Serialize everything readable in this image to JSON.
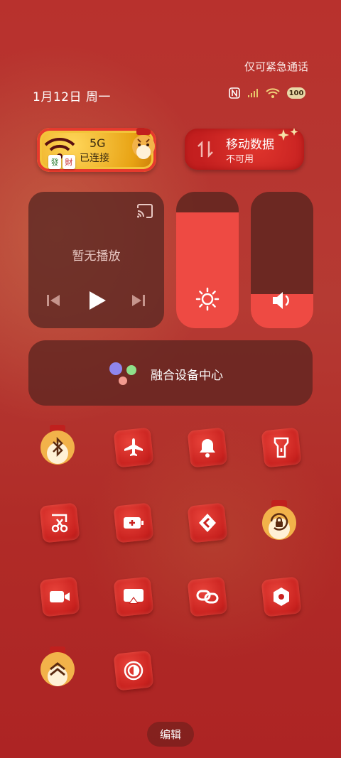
{
  "status_bar": {
    "emergency_text": "仅可紧急通话",
    "date": "1月12日 周一",
    "battery": "100",
    "icons": [
      "nfc-icon",
      "signal-icon",
      "wifi-icon",
      "battery-icon"
    ]
  },
  "wifi_tile": {
    "name": "5G",
    "sub": "已连接",
    "mahjong": [
      "發",
      "財"
    ]
  },
  "data_tile": {
    "title": "移动数据",
    "subtitle": "不可用"
  },
  "media": {
    "status": "暂无播放"
  },
  "sliders": {
    "brightness_level": 0.85,
    "volume_level": 0.25
  },
  "device_center": {
    "label": "融合设备中心"
  },
  "toggles": [
    {
      "name": "bluetooth",
      "icon": "bluetooth-icon"
    },
    {
      "name": "airplane-mode",
      "icon": "airplane-icon"
    },
    {
      "name": "do-not-disturb",
      "icon": "bell-icon"
    },
    {
      "name": "flashlight",
      "icon": "flashlight-icon"
    },
    {
      "name": "screenshot",
      "icon": "scissors-icon"
    },
    {
      "name": "battery-saver",
      "icon": "battery-saver-icon"
    },
    {
      "name": "nearby-share",
      "icon": "share-icon"
    },
    {
      "name": "auto-rotate",
      "icon": "rotate-lock-icon"
    },
    {
      "name": "screen-record",
      "icon": "video-icon"
    },
    {
      "name": "screen-cast",
      "icon": "cast-screen-icon"
    },
    {
      "name": "link",
      "icon": "link-icon"
    },
    {
      "name": "hotspot",
      "icon": "hexagon-icon"
    },
    {
      "name": "vpn",
      "icon": "chevron-badge-icon"
    },
    {
      "name": "dark-mode",
      "icon": "contrast-icon"
    }
  ],
  "edit_label": "编辑",
  "colors": {
    "accent_red": "#ee4a43",
    "panel_dark": "#5f2620",
    "gold": "#e8a314"
  }
}
